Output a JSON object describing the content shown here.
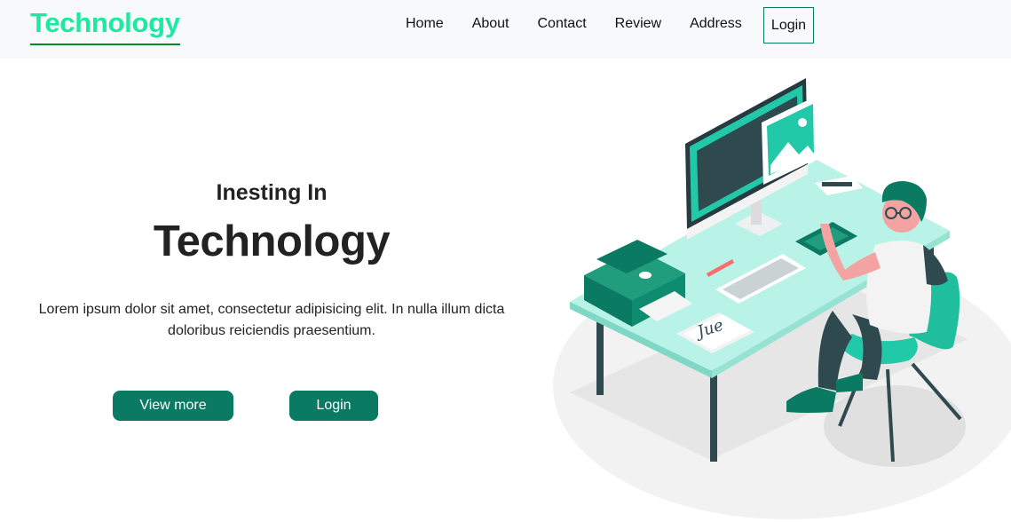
{
  "navbar": {
    "brand": "Technology",
    "links": [
      "Home",
      "About",
      "Contact",
      "Review",
      "Address"
    ],
    "login": "Login"
  },
  "hero": {
    "subtitle": "Inesting In",
    "title": "Technology",
    "description": "Lorem ipsum dolor sit amet, consectetur adipisicing elit. In nulla illum dicta doloribus reiciendis praesentium.",
    "buttons": {
      "view_more": "View more",
      "login": "Login"
    },
    "signature_text": "Jue"
  },
  "colors": {
    "brand": "#1de9a0",
    "brand_underline": "#0a8a1e",
    "primary": "#0b7a63",
    "accent": "#22c9a8",
    "navbar_bg": "#f8f9fa",
    "desk": "#b9f2e6"
  },
  "icons": {
    "hero_illustration": "person-at-desk-illustration"
  }
}
